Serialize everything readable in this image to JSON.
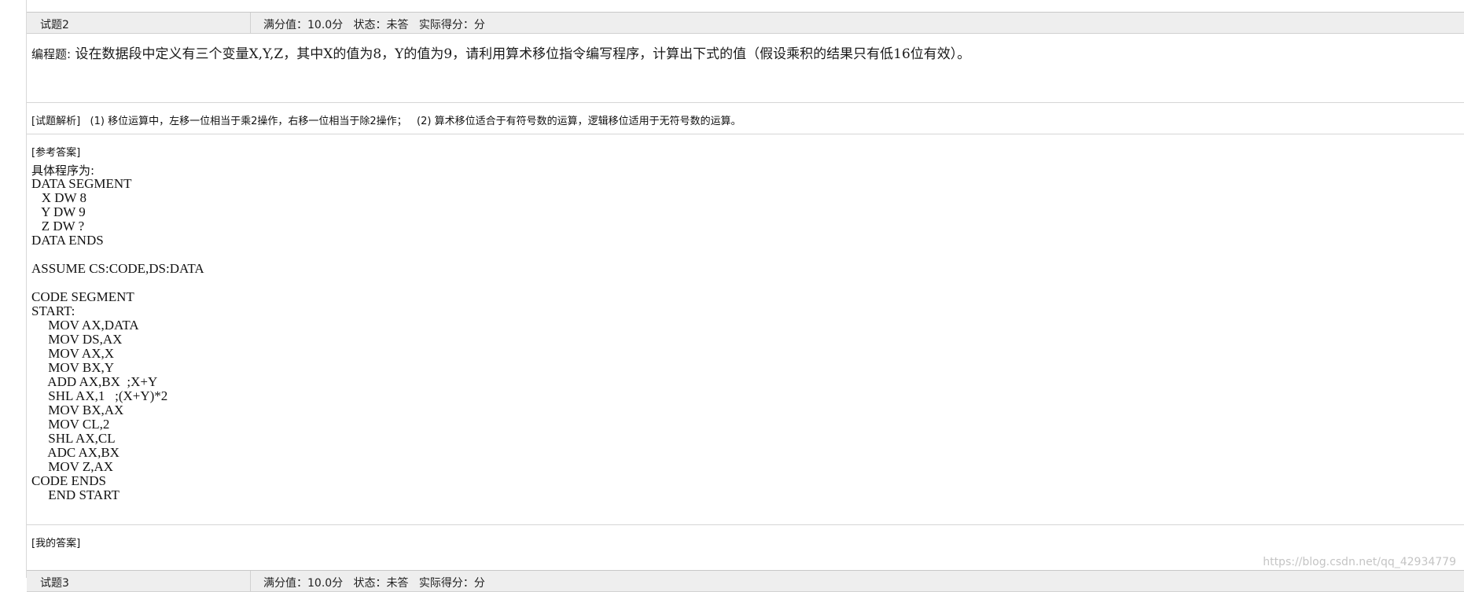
{
  "question_header": {
    "title": "试题2",
    "meta": "满分值：10.0分   状态：未答   实际得分：分"
  },
  "question": {
    "type_label": "编程题:",
    "text": " 设在数据段中定义有三个变量X,Y,Z，其中X的值为8，Y的值为9，请利用算术移位指令编写程序，计算出下式的值（假设乘积的结果只有低16位有效）。"
  },
  "analysis": {
    "text": "[试题解析]   (1) 移位运算中，左移一位相当于乘2操作，右移一位相当于除2操作；   (2) 算术移位适合于有符号数的运算，逻辑移位适用于无符号数的运算。"
  },
  "reference_answer": {
    "label": "[参考答案]",
    "intro": "具体程序为:",
    "code": "DATA SEGMENT\n   X DW 8\n   Y DW 9\n   Z DW ?\nDATA ENDS\n\nASSUME CS:CODE,DS:DATA\n\nCODE SEGMENT\nSTART:\n     MOV AX,DATA\n     MOV DS,AX\n     MOV AX,X\n     MOV BX,Y\n     ADD AX,BX  ;X+Y\n     SHL AX,1   ;(X+Y)*2\n     MOV BX,AX\n     MOV CL,2\n     SHL AX,CL\n     ADC AX,BX\n     MOV Z,AX\nCODE ENDS\n     END START"
  },
  "my_answer": {
    "label": "[我的答案]"
  },
  "next_question_header": {
    "title": "试题3",
    "meta": "满分值：10.0分   状态：未答   实际得分：分"
  },
  "watermark": "https://blog.csdn.net/qq_42934779"
}
